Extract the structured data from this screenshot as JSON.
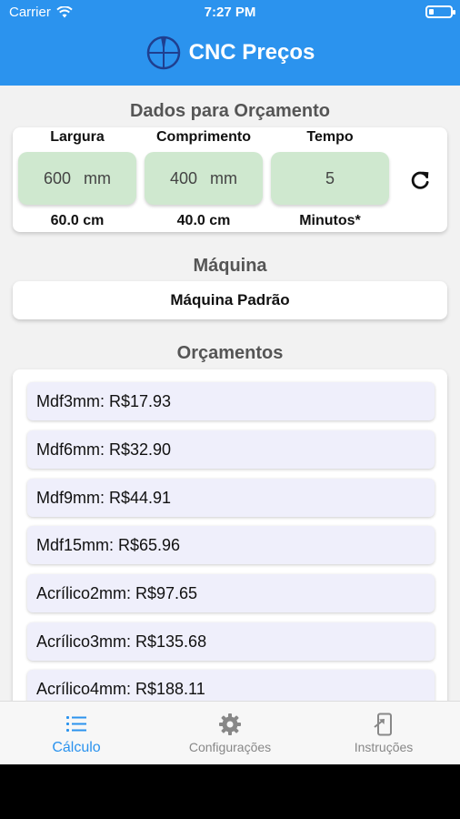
{
  "status_bar": {
    "carrier": "Carrier",
    "time": "7:27 PM"
  },
  "header": {
    "title": "CNC Preços"
  },
  "budget": {
    "section_title": "Dados para Orçamento",
    "columns": [
      {
        "label": "Largura",
        "value": "600",
        "unit": "mm",
        "below": "60.0 cm"
      },
      {
        "label": "Comprimento",
        "value": "400",
        "unit": "mm",
        "below": "40.0 cm"
      },
      {
        "label": "Tempo",
        "value": "5",
        "unit": "",
        "below": "Minutos*"
      }
    ]
  },
  "machine": {
    "section_title": "Máquina",
    "selected": "Máquina Padrão"
  },
  "quotes": {
    "section_title": "Orçamentos",
    "items": [
      "Mdf3mm: R$17.93",
      "Mdf6mm: R$32.90",
      "Mdf9mm: R$44.91",
      "Mdf15mm: R$65.96",
      "Acrílico2mm: R$97.65",
      "Acrílico3mm: R$135.68",
      "Acrílico4mm: R$188.11"
    ]
  },
  "tabs": [
    {
      "label": "Cálculo",
      "icon": "list-icon",
      "active": true
    },
    {
      "label": "Configurações",
      "icon": "gear-icon",
      "active": false
    },
    {
      "label": "Instruções",
      "icon": "phone-arrow-icon",
      "active": false
    }
  ],
  "colors": {
    "header": "#2b93ee",
    "input_bg": "#cfe8cf",
    "quote_bg": "#efeffb",
    "active_tab": "#2b93ee"
  }
}
